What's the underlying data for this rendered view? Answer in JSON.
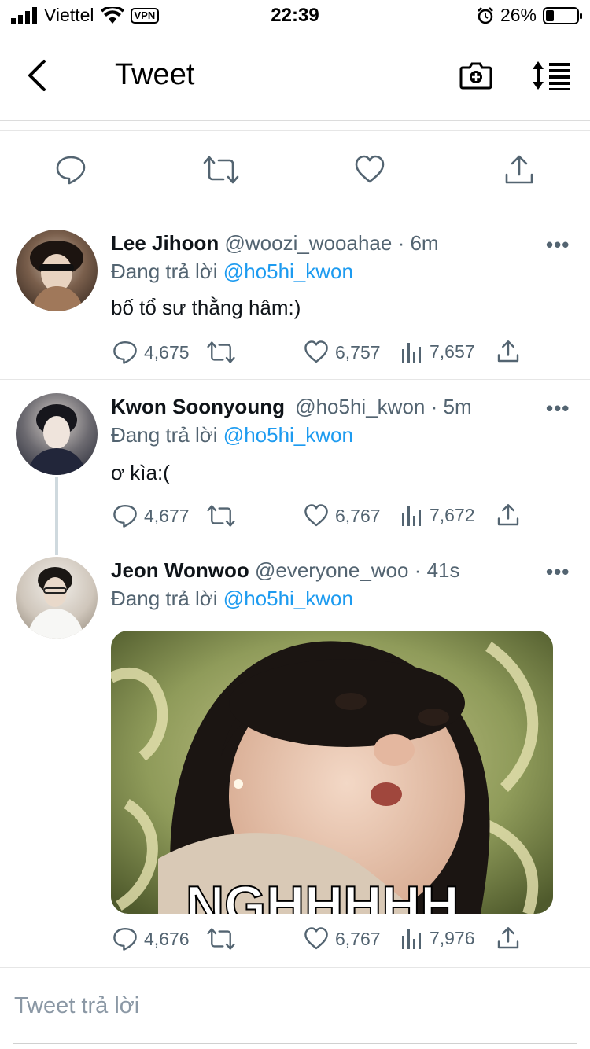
{
  "status_bar": {
    "carrier": "Viettel",
    "vpn": "VPN",
    "time": "22:39",
    "battery": "26%",
    "battery_level": 0.26
  },
  "nav": {
    "title": "Tweet",
    "back_icon": "chevron-left-icon",
    "camera_icon": "camera-plus-icon",
    "sort_icon": "sort-icon"
  },
  "action_bar": {
    "icons": [
      "reply-icon",
      "retweet-icon",
      "like-icon",
      "share-icon"
    ]
  },
  "tweets": [
    {
      "name": "Lee Jihoon",
      "handle": "@woozi_wooahae",
      "time": "· 6m",
      "reply_prefix": "Đang trả lời",
      "reply_to": "@ho5hi_kwon",
      "text": "bố tổ sư thằng hâm:)",
      "replies": "4,675",
      "likes": "6,757",
      "views": "7,657"
    },
    {
      "name": "Kwon Soonyoung",
      "handle": "@ho5hi_kwon",
      "time": "· 5m",
      "reply_prefix": "Đang trả lời",
      "reply_to": "@ho5hi_kwon",
      "text": "ơ kìa:(",
      "replies": "4,677",
      "likes": "6,767",
      "views": "7,672"
    },
    {
      "name": "Jeon Wonwoo",
      "handle": "@everyone_woo",
      "time": "· 41s",
      "reply_prefix": "Đang trả lời",
      "reply_to": "@ho5hi_kwon",
      "text": "",
      "media_caption": "NGHHHHH",
      "replies": "4,676",
      "likes": "6,767",
      "views": "7,976"
    }
  ],
  "compose": {
    "placeholder": "Tweet trả lời"
  },
  "colors": {
    "accent": "#1d9bf0",
    "secondary_text": "#536471"
  }
}
